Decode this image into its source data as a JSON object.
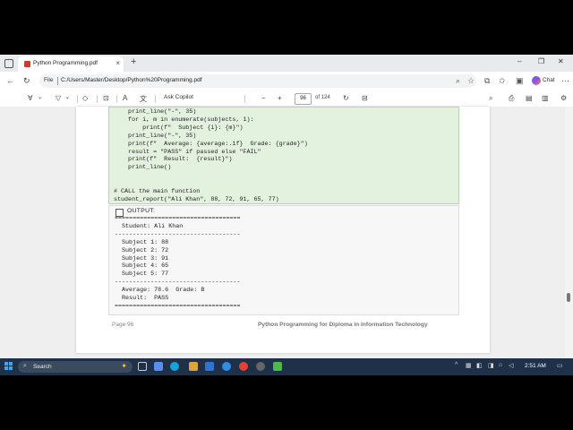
{
  "browser": {
    "tab_title": "Python Programming.pdf",
    "tab_close": "×",
    "new_tab": "+",
    "address_label": "File",
    "address_url": "C:/Users/Master/Desktop/Python%20Programming.pdf",
    "chat_label": "Chat",
    "window_controls": {
      "minimize": "–",
      "restore": "❐",
      "close": "✕"
    }
  },
  "pdf_toolbar": {
    "ask_copilot": "Ask Copilot",
    "zoom_out": "−",
    "zoom_in": "+",
    "page_number": "96",
    "page_of": "of 124"
  },
  "code_lines": [
    "    print_line(\"-\", 35)",
    "    for i, m in enumerate(subjects, 1):",
    "        print(f\"  Subject {i}: {m}\")",
    "    print_line(\"-\", 35)",
    "    print(f\"  Average: {average:.1f}  Grade: {grade}\")",
    "    result = \"PASS\" if passed else \"FAIL\"",
    "    print(f\"  Result:  {result}\")",
    "    print_line()",
    "",
    "",
    "# CALL the main function",
    "student_report(\"Ali Khan\", 88, 72, 91, 65, 77)"
  ],
  "output": {
    "label": "OUTPUT:",
    "lines": [
      "===================================",
      "  Student: Ali Khan",
      "-----------------------------------",
      "  Subject 1: 88",
      "  Subject 2: 72",
      "  Subject 3: 91",
      "  Subject 4: 65",
      "  Subject 5: 77",
      "-----------------------------------",
      "  Average: 78.6  Grade: B",
      "  Result:  PASS",
      "==================================="
    ]
  },
  "footer": {
    "page_label": "Page 96",
    "book_title": "Python Programming for Diploma in Information Technology"
  },
  "taskbar": {
    "search_label": "Search",
    "time": "2:51 AM"
  },
  "colors": {
    "code_bg": "#e3f2df",
    "output_bg": "#f7f7f7",
    "taskbar_bg": "#1f3049",
    "pdf_icon": "#d23a2b"
  }
}
